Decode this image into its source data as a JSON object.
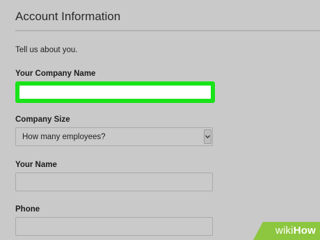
{
  "section": {
    "title": "Account Information",
    "intro": "Tell us about you."
  },
  "fields": {
    "company_name": {
      "label": "Your Company Name",
      "value": ""
    },
    "company_size": {
      "label": "Company Size",
      "selected": "How many employees?"
    },
    "your_name": {
      "label": "Your Name",
      "value": ""
    },
    "phone": {
      "label": "Phone",
      "value": ""
    }
  },
  "watermark": {
    "prefix": "wiki",
    "suffix": "How"
  },
  "colors": {
    "background": "#c9c9c9",
    "focus_highlight": "#19e319",
    "watermark_green": "#8dc63f"
  },
  "icons": {
    "select_arrow": "chevron-down-icon"
  }
}
